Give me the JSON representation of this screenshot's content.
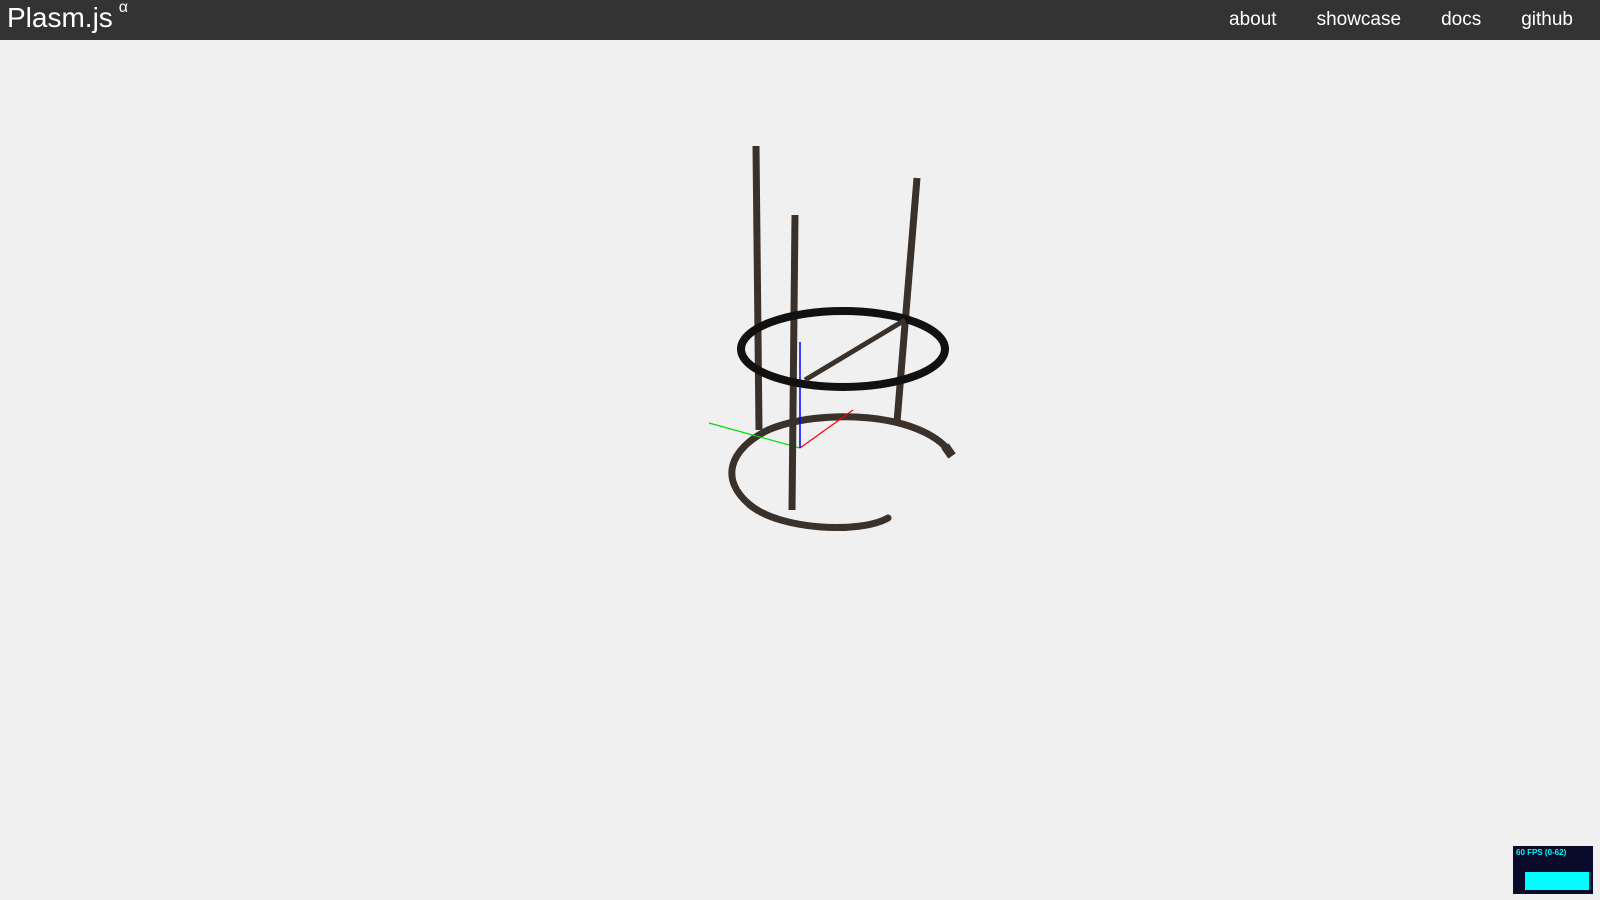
{
  "header": {
    "brand": "Plasm.js",
    "brand_superscript": "α",
    "nav": [
      {
        "label": "about"
      },
      {
        "label": "showcase"
      },
      {
        "label": "docs"
      },
      {
        "label": "github"
      }
    ]
  },
  "stats_panel": {
    "fps_label": "60 FPS (0-62)",
    "fps": 60,
    "fps_max": 62
  },
  "colors": {
    "header_bg": "#333333",
    "viewport_bg": "#f0f0f0",
    "model": "#3a312b",
    "ring": "#111111",
    "axis_x": "#ff0000",
    "axis_y": "#00dd00",
    "axis_z": "#0000ff",
    "stats_bg": "#0a0a2a",
    "stats_fg": "#00ffff"
  }
}
